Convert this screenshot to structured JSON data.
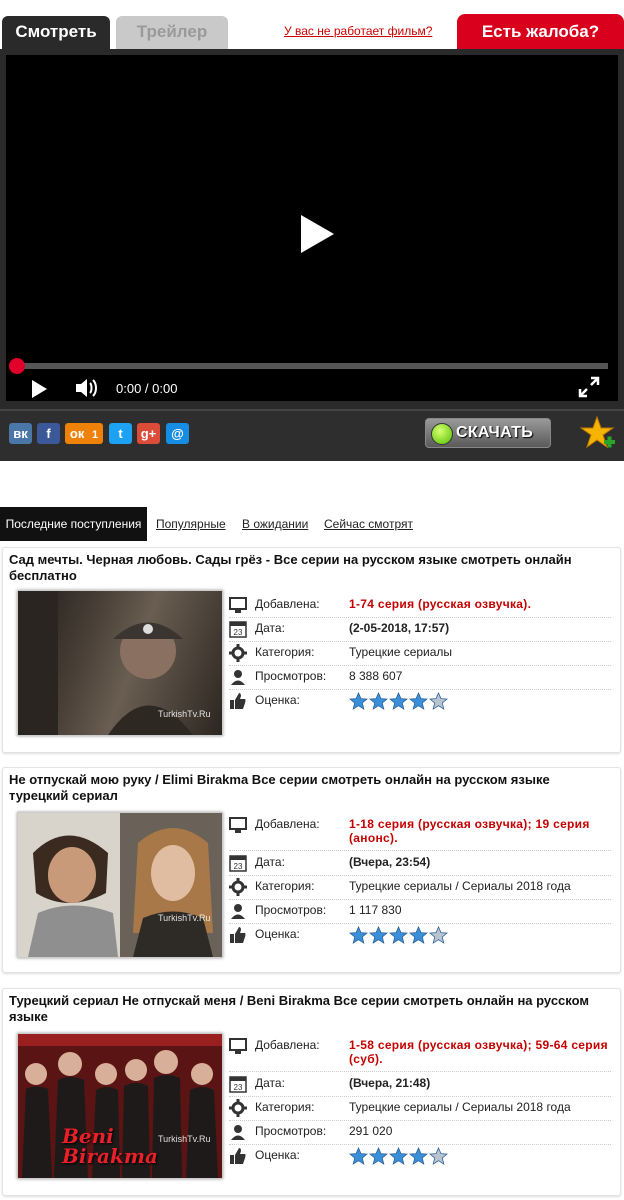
{
  "tabs": {
    "watch": "Смотреть",
    "trailer": "Трейлер"
  },
  "problem_link": "У вас не работает фильм?",
  "complaint": "Есть жалоба?",
  "player": {
    "time": "0:00 / 0:00",
    "progress": 0
  },
  "share": {
    "icons": [
      "vk-icon",
      "facebook-icon",
      "odnoklassniki-icon",
      "twitter-icon",
      "google-plus-icon",
      "mail-icon"
    ],
    "ok_count": "1",
    "download": "СКАЧАТЬ"
  },
  "list_tabs": [
    "Последние поступления",
    "Популярные",
    "В ожидании",
    "Сейчас смотрят"
  ],
  "labels": {
    "added": "Добавлена:",
    "date": "Дата:",
    "category": "Категория:",
    "views": "Просмотров:",
    "rating": "Оценка:"
  },
  "items": [
    {
      "title": "Сад мечты. Черная любовь. Сады грёз - Все серии на русском языке смотреть онлайн бесплатно",
      "added": "1-74 серия (русская озвучка).",
      "date": "(2-05-2018, 17:57)",
      "category": "Турецкие сериалы",
      "views": "8 388 607",
      "rating": 4,
      "watermark": "TurkishTv.Ru"
    },
    {
      "title": "Не отпускай мою руку / Elimi Birakma Все серии смотреть онлайн на русском языке турецкий сериал",
      "added": "1-18 серия (русская озвучка); 19 серия (анонс).",
      "date": "(Вчера, 23:54)",
      "category": "Турецкие сериалы / Сериалы 2018 года",
      "views": "1 117 830",
      "rating": 4,
      "watermark": "TurkishTv.Ru"
    },
    {
      "title": "Турецкий сериал Не отпускай меня / Beni Birakma Все серии смотреть онлайн на русском языке",
      "added": "1-58 серия (русская озвучка); 59-64 серия (суб).",
      "date": "(Вчера, 21:48)",
      "category": "Турецкие сериалы / Сериалы 2018 года",
      "views": "291 020",
      "rating": 4,
      "watermark": "TurkishTv.Ru",
      "poster_text": "Beni Birakma"
    }
  ],
  "colors": {
    "accent": "#d8001c",
    "link": "#c00",
    "star": "#3a90d8"
  }
}
